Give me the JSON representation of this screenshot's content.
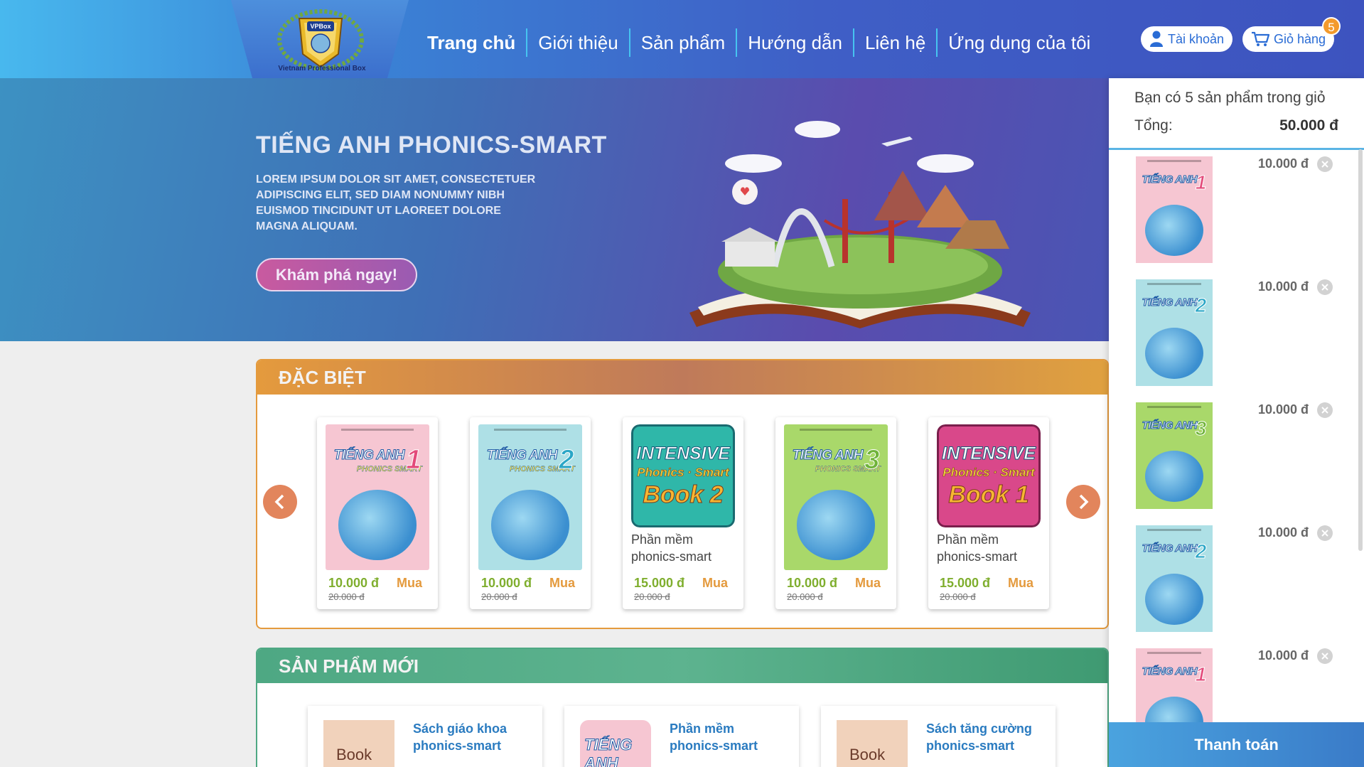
{
  "header": {
    "logo_text": "Vietnam Professional Box",
    "logo_mark": "VPBox",
    "nav": [
      "Trang chủ",
      "Giới thiệu",
      "Sản phẩm",
      "Hướng dẫn",
      "Liên hệ",
      "Ứng dụng của tôi"
    ],
    "account_label": "Tài khoản",
    "cart_label": "Giỏ hàng",
    "cart_count": "5"
  },
  "banner": {
    "title": "TIẾNG ANH PHONICS-SMART",
    "description": "LOREM IPSUM DOLOR SIT AMET, CONSECTETUER ADIPISCING ELIT, SED DIAM NONUMMY NIBH EUISMOD TINCIDUNT UT LAOREET DOLORE MAGNA ALIQUAM.",
    "button": "Khám phá ngay!"
  },
  "special": {
    "heading": "ĐẶC BIỆT",
    "buy_label": "Mua",
    "items": [
      {
        "type": "book",
        "num": "1",
        "color": "#f6c6d2",
        "price": "10.000 đ",
        "old_price": "20.000 đ",
        "name": ""
      },
      {
        "type": "book",
        "num": "2",
        "color": "#aee0e6",
        "price": "10.000 đ",
        "old_price": "20.000 đ",
        "name": ""
      },
      {
        "type": "software",
        "book": "Book 2",
        "color": "#2fb7a9",
        "price": "15.000 đ",
        "old_price": "20.000 đ",
        "name": "Phần mềm phonics-smart"
      },
      {
        "type": "book",
        "num": "3",
        "color": "#a9d86a",
        "price": "10.000 đ",
        "old_price": "20.000 đ",
        "name": ""
      },
      {
        "type": "software",
        "book": "Book 1",
        "color": "#d9488a",
        "price": "15.000 đ",
        "old_price": "20.000 đ",
        "name": "Phần mềm phonics-smart"
      }
    ]
  },
  "new_products": {
    "heading": "SẢN PHẨM MỚI",
    "items": [
      {
        "title": "Sách giáo khoa phonics-smart",
        "thumb": "Book"
      },
      {
        "title": "Phần mềm phonics-smart",
        "thumb": "TIẾNG ANH"
      },
      {
        "title": "Sách tăng cường phonics-smart",
        "thumb": "Book"
      }
    ]
  },
  "cart": {
    "summary": "Bạn có 5 sản phẩm trong giỏ",
    "total_label": "Tổng:",
    "total_value": "50.000 đ",
    "items": [
      {
        "num": "1",
        "color": "#f6c6d2",
        "price": "10.000 đ"
      },
      {
        "num": "2",
        "color": "#aee0e6",
        "price": "10.000 đ"
      },
      {
        "num": "3",
        "color": "#a9d86a",
        "price": "10.000 đ"
      },
      {
        "num": "2",
        "color": "#aee0e6",
        "price": "10.000 đ"
      },
      {
        "num": "1",
        "color": "#f6c6d2",
        "price": "10.000 đ"
      }
    ],
    "checkout": "Thanh toán"
  },
  "cover_text": {
    "line1": "TIẾNG ANH",
    "line2": "PHONICS SMART",
    "intensive": "INTENSIVE",
    "phonics": "Phonics · Smart"
  },
  "colors": {
    "accent_orange": "#e49a3d",
    "accent_green": "#4ea883",
    "brand_blue": "#3d53bf",
    "price_green": "#7fae2e"
  }
}
